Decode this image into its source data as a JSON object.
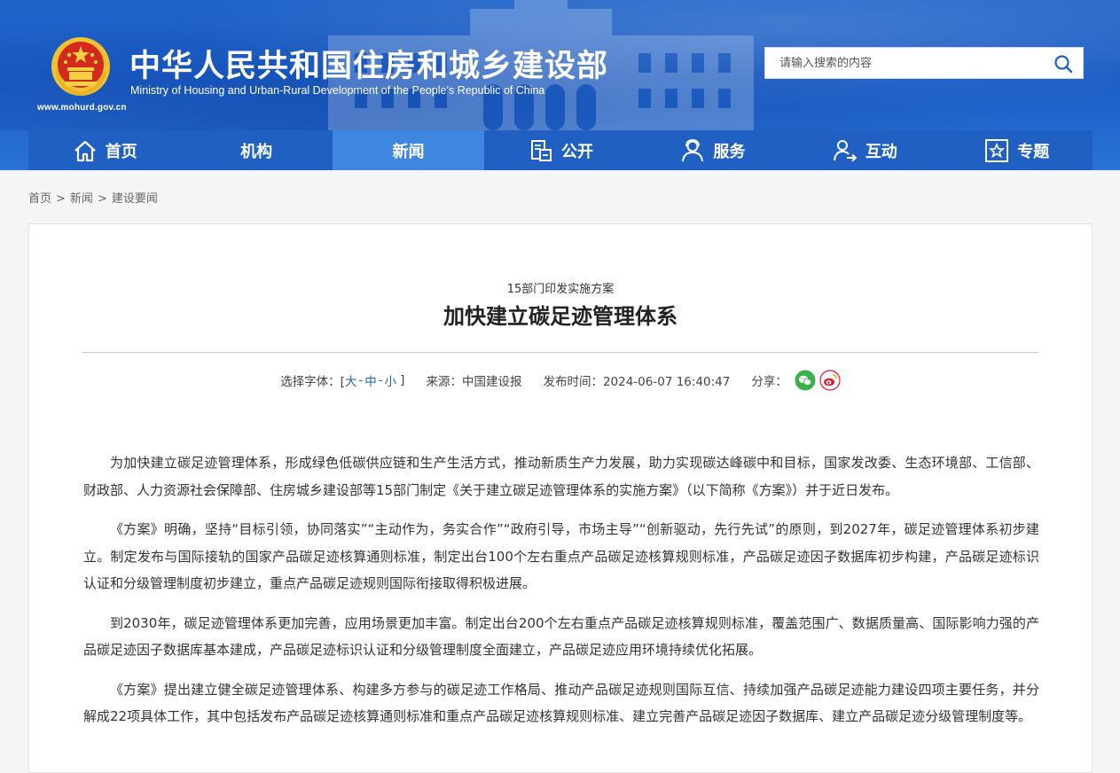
{
  "header": {
    "site_title": "中华人民共和国住房和城乡建设部",
    "site_subtitle": "Ministry of Housing and Urban-Rural Development of the People’s Republic of China",
    "site_url": "www.mohurd.gov.cn",
    "search_placeholder": "请输入搜索的内容",
    "search_icon": "search-icon"
  },
  "nav": {
    "items": [
      {
        "label": "首页",
        "icon": "home-icon"
      },
      {
        "label": "机构",
        "icon": ""
      },
      {
        "label": "新闻",
        "icon": "",
        "active": true
      },
      {
        "label": "公开",
        "icon": "document-icon"
      },
      {
        "label": "服务",
        "icon": "service-user-icon"
      },
      {
        "label": "互动",
        "icon": "interact-user-icon"
      },
      {
        "label": "专题",
        "icon": "star-box-icon"
      }
    ]
  },
  "breadcrumb": {
    "items": [
      "首页",
      "新闻",
      "建设要闻"
    ],
    "separator": ">"
  },
  "article": {
    "subhead": "15部门印发实施方案",
    "headline": "加快建立碳足迹管理体系",
    "font_label": "选择字体：[",
    "font_large": "大",
    "font_medium": "中",
    "font_small": "小",
    "font_close": "]",
    "font_dash": "-",
    "source": "来源：中国建设报",
    "published": "发布时间：2024-06-07 16:40:47",
    "share_label": "分享：",
    "share_wechat_color": "#3bb14a",
    "share_weibo_color": "#e6162d",
    "paragraphs": [
      "为加快建立碳足迹管理体系，形成绿色低碳供应链和生产生活方式，推动新质生产力发展，助力实现碳达峰碳中和目标，国家发改委、生态环境部、工信部、财政部、人力资源社会保障部、住房城乡建设部等15部门制定《关于建立碳足迹管理体系的实施方案》（以下简称《方案》）并于近日发布。",
      "《方案》明确，坚持“目标引领，协同落实”“主动作为，务实合作”“政府引导，市场主导”“创新驱动，先行先试”的原则，到2027年，碳足迹管理体系初步建立。制定发布与国际接轨的国家产品碳足迹核算通则标准，制定出台100个左右重点产品碳足迹核算规则标准，产品碳足迹因子数据库初步构建，产品碳足迹标识认证和分级管理制度初步建立，重点产品碳足迹规则国际衔接取得积极进展。",
      "到2030年，碳足迹管理体系更加完善，应用场景更加丰富。制定出台200个左右重点产品碳足迹核算规则标准，覆盖范围广、数据质量高、国际影响力强的产品碳足迹因子数据库基本建成，产品碳足迹标识认证和分级管理制度全面建立，产品碳足迹应用环境持续优化拓展。",
      "《方案》提出建立健全碳足迹管理体系、构建多方参与的碳足迹工作格局、推动产品碳足迹规则国际互信、持续加强产品碳足迹能力建设四项主要任务，并分解成22项具体工作，其中包括发布产品碳足迹核算通则标准和重点产品碳足迹核算规则标准、建立完善产品碳足迹因子数据库、建立产品碳足迹分级管理制度等。"
    ]
  },
  "colors": {
    "header_blue": "#1f63c9",
    "nav_blue": "#1f60c2",
    "nav_active": "#3f86e0",
    "link_blue": "#1f60c2"
  }
}
